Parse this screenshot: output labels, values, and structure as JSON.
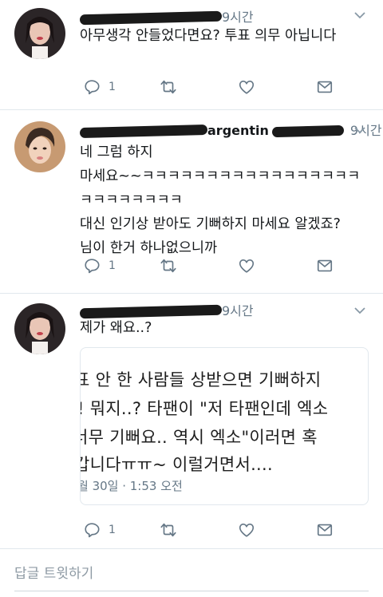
{
  "tweets": [
    {
      "time": "9시간",
      "lines": [
        "아무생각 안들었다면요? 투표 의무 아닙니다"
      ],
      "reply_count": "1",
      "retweet_count": "",
      "like_count": ""
    },
    {
      "time": "9시간",
      "name_visible": "argentin",
      "lines": [
        "네 그럼 하지",
        "마세요~~ㅋㅋㅋㅋㅋㅋㅋㅋㅋㅋㅋㅋㅋㅋㅋㅋㅋ",
        "ㅋㅋㅋㅋㅋㅋㅋㅋ",
        "대신 인기상 받아도 기뻐하지 마세요 알겠죠?",
        "님이 한거 하나없으니까"
      ],
      "reply_count": "1",
      "retweet_count": "",
      "like_count": ""
    },
    {
      "time": "9시간",
      "lines": [
        "제가 왜요..?"
      ],
      "reply_count": "1",
      "retweet_count": "",
      "like_count": "",
      "quote": {
        "lines": [
          "표 안 한 사람들 상받으면 기뻐하지",
          "! 뭐지..? 타팬이 \"저 타팬인데 엑소",
          "너무 기뻐요.. 역시 엑소\"이러면 혹",
          "갑니다ㅠㅠ~ 이럴거면서...."
        ],
        "date": "월 30일 · 1:53 오전"
      }
    }
  ],
  "reply_bar": {
    "placeholder": "답글 트윗하기"
  },
  "icons": {
    "reply": "reply-icon",
    "retweet": "retweet-icon",
    "like": "heart-icon",
    "dm": "mail-icon",
    "caret": "chevron-down-icon"
  },
  "colors": {
    "icon_gray": "#657786",
    "text": "#14171a",
    "border": "#e1e8ed"
  }
}
